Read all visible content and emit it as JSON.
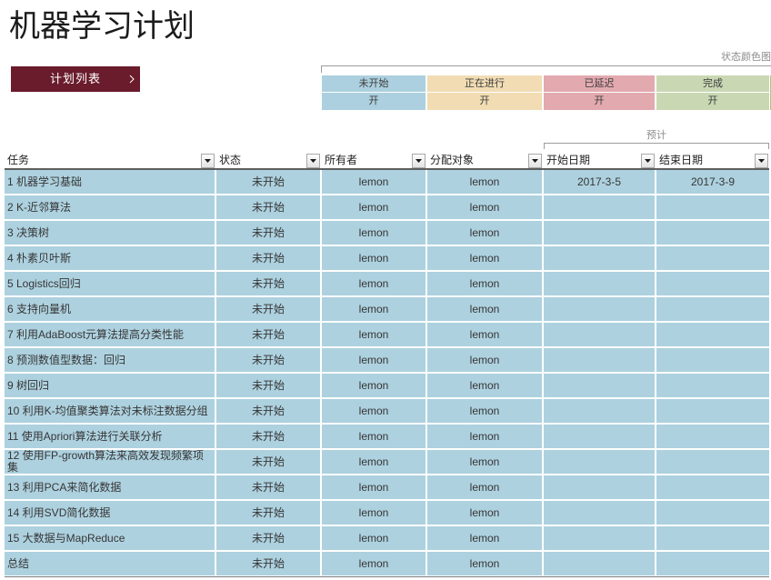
{
  "title": "机器学习计划",
  "nav_button": {
    "label": "计划列表",
    "icon": "chevron-right-icon"
  },
  "colors": {
    "nav_button": "#6a1c2c"
  },
  "legend": {
    "title": "状态颜色图",
    "items": [
      {
        "label": "未开始",
        "value": "开",
        "color": "#acd0df"
      },
      {
        "label": "正在进行",
        "value": "开",
        "color": "#f1dcb3"
      },
      {
        "label": "已延迟",
        "value": "开",
        "color": "#e2a9af"
      },
      {
        "label": "完成",
        "value": "开",
        "color": "#c9d8b3"
      }
    ]
  },
  "table": {
    "row_color": "#add1df",
    "group_label": "预计",
    "filter_icon": "dropdown-arrow-icon",
    "columns": [
      "任务",
      "状态",
      "所有者",
      "分配对象",
      "开始日期",
      "结束日期"
    ],
    "rows": [
      {
        "task": "1 机器学习基础",
        "status": "未开始",
        "owner": "lemon",
        "assignee": "lemon",
        "start": "2017-3-5",
        "end": "2017-3-9"
      },
      {
        "task": "2 K-近邻算法",
        "status": "未开始",
        "owner": "lemon",
        "assignee": "lemon",
        "start": "",
        "end": ""
      },
      {
        "task": "3 决策树",
        "status": "未开始",
        "owner": "lemon",
        "assignee": "lemon",
        "start": "",
        "end": ""
      },
      {
        "task": "4 朴素贝叶斯",
        "status": "未开始",
        "owner": "lemon",
        "assignee": "lemon",
        "start": "",
        "end": ""
      },
      {
        "task": "5 Logistics回归",
        "status": "未开始",
        "owner": "lemon",
        "assignee": "lemon",
        "start": "",
        "end": ""
      },
      {
        "task": "6 支持向量机",
        "status": "未开始",
        "owner": "lemon",
        "assignee": "lemon",
        "start": "",
        "end": ""
      },
      {
        "task": "7 利用AdaBoost元算法提高分类性能",
        "status": "未开始",
        "owner": "lemon",
        "assignee": "lemon",
        "start": "",
        "end": ""
      },
      {
        "task": "8 预测数值型数据：回归",
        "status": "未开始",
        "owner": "lemon",
        "assignee": "lemon",
        "start": "",
        "end": ""
      },
      {
        "task": "9 树回归",
        "status": "未开始",
        "owner": "lemon",
        "assignee": "lemon",
        "start": "",
        "end": ""
      },
      {
        "task": "10 利用K-均值聚类算法对未标注数据分组",
        "status": "未开始",
        "owner": "lemon",
        "assignee": "lemon",
        "start": "",
        "end": ""
      },
      {
        "task": "11 使用Apriori算法进行关联分析",
        "status": "未开始",
        "owner": "lemon",
        "assignee": "lemon",
        "start": "",
        "end": ""
      },
      {
        "task": "12 使用FP-growth算法来高效发现频繁项集",
        "status": "未开始",
        "owner": "lemon",
        "assignee": "lemon",
        "start": "",
        "end": ""
      },
      {
        "task": "13 利用PCA来简化数据",
        "status": "未开始",
        "owner": "lemon",
        "assignee": "lemon",
        "start": "",
        "end": ""
      },
      {
        "task": "14 利用SVD简化数据",
        "status": "未开始",
        "owner": "lemon",
        "assignee": "lemon",
        "start": "",
        "end": ""
      },
      {
        "task": "15 大数据与MapReduce",
        "status": "未开始",
        "owner": "lemon",
        "assignee": "lemon",
        "start": "",
        "end": ""
      },
      {
        "task": "总结",
        "status": "未开始",
        "owner": "lemon",
        "assignee": "lemon",
        "start": "",
        "end": ""
      }
    ]
  }
}
